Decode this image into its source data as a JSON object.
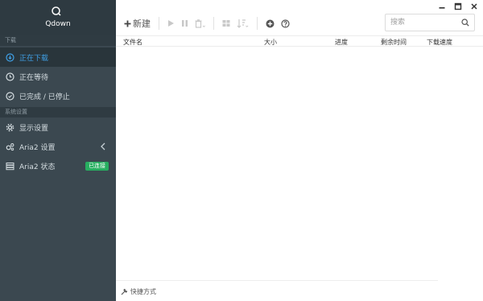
{
  "app": {
    "name": "Qdown"
  },
  "sidebar": {
    "section_download": "下载",
    "section_system": "系统设置",
    "items": [
      {
        "label": "正在下载",
        "icon": "download-circle-icon",
        "active": true
      },
      {
        "label": "正在等待",
        "icon": "clock-icon",
        "active": false
      },
      {
        "label": "已完成 / 已停止",
        "icon": "check-circle-icon",
        "active": false
      }
    ],
    "settings": [
      {
        "label": "显示设置",
        "icon": "gear-icon"
      },
      {
        "label": "Aria2 设置",
        "icon": "gears-icon"
      },
      {
        "label": "Aria2 状态",
        "icon": "server-icon",
        "badge": "已连接"
      }
    ]
  },
  "toolbar": {
    "new_label": "新建"
  },
  "search": {
    "placeholder": "搜索"
  },
  "table": {
    "columns": [
      "文件名",
      "大小",
      "进度",
      "剩余时间",
      "下载速度"
    ]
  },
  "footer": {
    "shortcut_label": "快捷方式"
  },
  "colors": {
    "sidebar": "#3b4850",
    "accent": "#3fa0e6",
    "badge": "#27ae60"
  }
}
